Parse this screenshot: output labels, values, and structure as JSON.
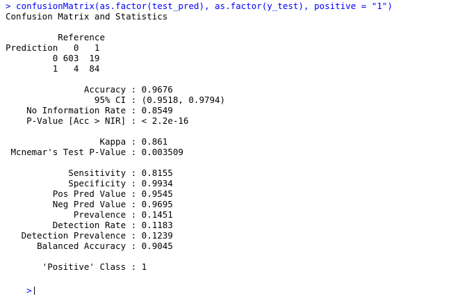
{
  "console": {
    "command_line": "> confusionMatrix(as.factor(test_pred), as.factor(y_test), positive = \"1\")",
    "title": "Confusion Matrix and Statistics",
    "matrix": [
      "          Reference",
      "Prediction   0   1",
      "         0 603  19",
      "         1   4  84"
    ],
    "stats_block_1": [
      "               Accuracy : 0.9676",
      "                 95% CI : (0.9518, 0.9794)",
      "    No Information Rate : 0.8549",
      "    P-Value [Acc > NIR] : < 2.2e-16"
    ],
    "stats_block_2": [
      "                  Kappa : 0.861",
      " Mcnemar's Test P-Value : 0.003509"
    ],
    "stats_block_3": [
      "            Sensitivity : 0.8155",
      "            Specificity : 0.9934",
      "         Pos Pred Value : 0.9545",
      "         Neg Pred Value : 0.9695",
      "             Prevalence : 0.1451",
      "         Detection Rate : 0.1183",
      "   Detection Prevalence : 0.1239",
      "      Balanced Accuracy : 0.9045"
    ],
    "positive_class": "       'Positive' Class : 1",
    "prompt": ">"
  },
  "colors": {
    "command": "#0000ff",
    "output": "#000000",
    "background": "#ffffff"
  }
}
